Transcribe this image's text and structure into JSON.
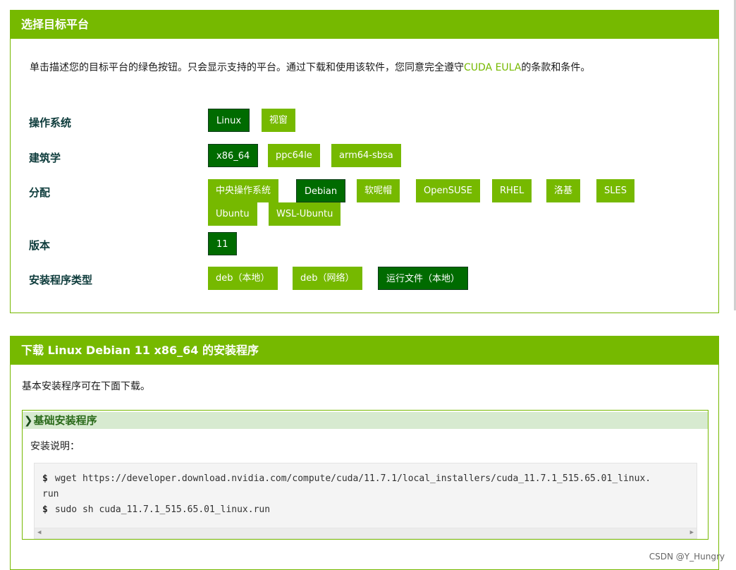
{
  "panel1": {
    "title": "选择目标平台",
    "intro_before": "单击描述您的目标平台的绿色按钮。只会显示支持的平台。通过下载和使用该软件，您同意完全遵守",
    "intro_link": "CUDA EULA",
    "intro_after": "的条款和条件。",
    "rows": {
      "os": {
        "label": "操作系统",
        "options": [
          "Linux",
          "视窗"
        ],
        "selected": "Linux"
      },
      "arch": {
        "label": "建筑学",
        "options": [
          "x86_64",
          "ppc64le",
          "arm64-sbsa"
        ],
        "selected": "x86_64"
      },
      "dist": {
        "label": "分配",
        "options": [
          "中央操作系统",
          "Debian",
          "软呢帽",
          "OpenSUSE",
          "RHEL",
          "洛基",
          "SLES",
          "Ubuntu",
          "WSL-Ubuntu"
        ],
        "selected": "Debian"
      },
      "version": {
        "label": "版本",
        "options": [
          "11"
        ],
        "selected": "11"
      },
      "installer": {
        "label": "安装程序类型",
        "options": [
          "deb（本地）",
          "deb（网络）",
          "运行文件（本地）"
        ],
        "selected": "运行文件（本地）"
      }
    }
  },
  "panel2": {
    "title": "下载 Linux Debian 11 x86_64 的安装程序",
    "text": "基本安装程序可在下面下载。",
    "section": {
      "title": "基础安装程序",
      "note": "安装说明：",
      "prompt": "$",
      "lines": [
        "wget https://developer.download.nvidia.com/compute/cuda/11.7.1/local_installers/cuda_11.7.1_515.65.01_linux.",
        "run",
        "sudo sh cuda_11.7.1_515.65.01_linux.run"
      ]
    }
  },
  "watermark": "CSDN @Y_Hungry",
  "colors": {
    "accent": "#76b900",
    "selected": "#006b00",
    "subheader": "#d7ead0"
  }
}
